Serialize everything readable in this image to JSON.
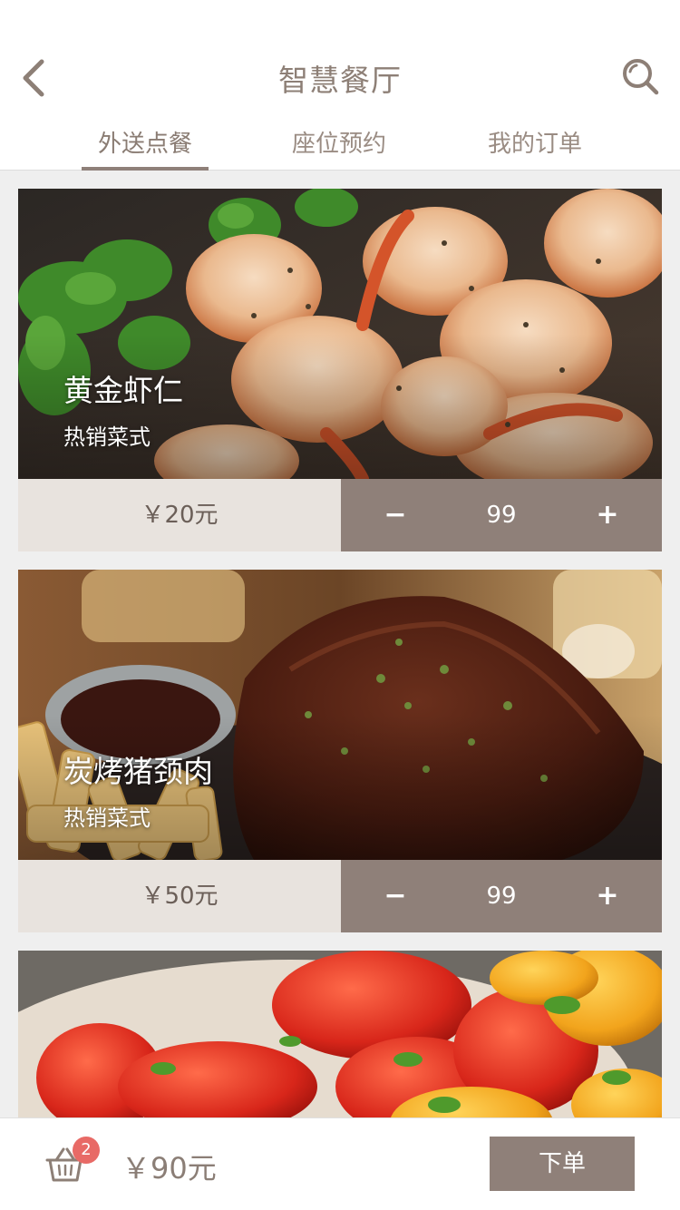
{
  "header": {
    "title": "智慧餐厅",
    "back_icon": "chevron-left-icon",
    "search_icon": "search-icon"
  },
  "tabs": [
    {
      "label": "外送点餐",
      "active": true
    },
    {
      "label": "座位预约",
      "active": false
    },
    {
      "label": "我的订单",
      "active": false
    }
  ],
  "foods": [
    {
      "name": "黄金虾仁",
      "tag": "热销菜式",
      "price": "￥20元",
      "quantity": "99",
      "minus_label": "−",
      "plus_label": "+"
    },
    {
      "name": "炭烤猪颈肉",
      "tag": "热销菜式",
      "price": "￥50元",
      "quantity": "99",
      "minus_label": "−",
      "plus_label": "+"
    }
  ],
  "cart": {
    "icon": "basket-icon",
    "badge_count": "2",
    "total": "￥90元",
    "order_button": "下单"
  },
  "colors": {
    "brand": "#8f8079",
    "price_bg": "#e8e3de",
    "badge": "#e86a66",
    "title_text": "#8d7f76"
  }
}
